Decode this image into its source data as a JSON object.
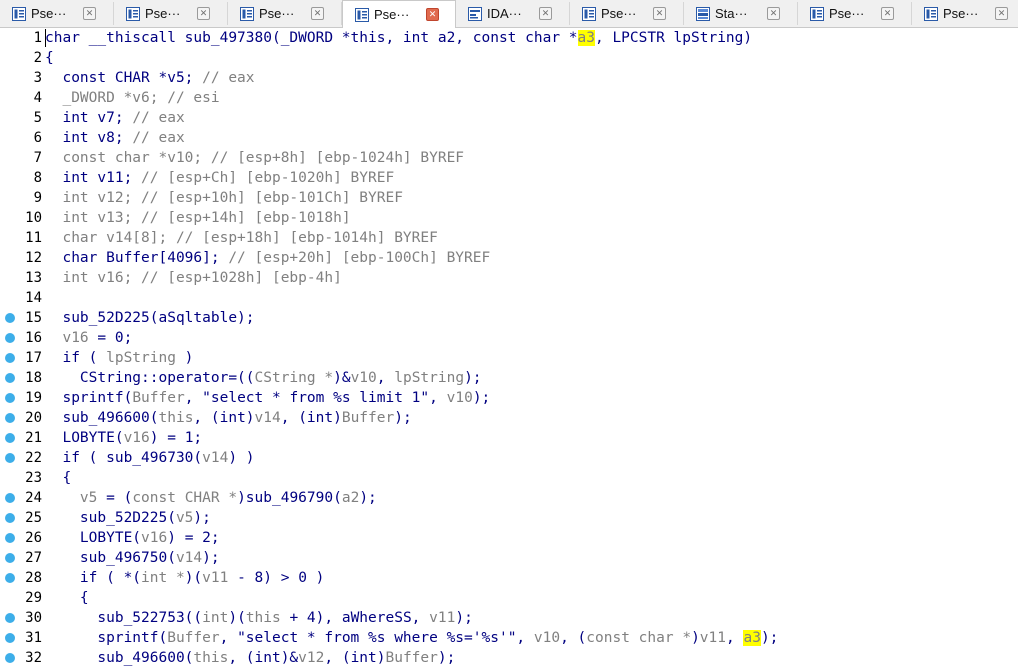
{
  "tabs": [
    {
      "label": "Pse···",
      "icon": "pseudocode-icon",
      "active": false
    },
    {
      "label": "Pse···",
      "icon": "pseudocode-icon",
      "active": false
    },
    {
      "label": "Pse···",
      "icon": "pseudocode-icon",
      "active": false
    },
    {
      "label": "Pse···",
      "icon": "pseudocode-icon",
      "active": true
    },
    {
      "label": "IDA···",
      "icon": "ida-view-icon",
      "active": false
    },
    {
      "label": "Pse···",
      "icon": "pseudocode-icon",
      "active": false
    },
    {
      "label": "Sta···",
      "icon": "stack-view-icon",
      "active": false
    },
    {
      "label": "Pse···",
      "icon": "pseudocode-icon",
      "active": false
    },
    {
      "label": "Pse···",
      "icon": "pseudocode-icon",
      "active": false
    }
  ],
  "colors": {
    "code_text": "#000080",
    "comment_and_var": "#808080",
    "highlight": "#ffff00",
    "breakpoint_dot": "#3daee9",
    "active_tab_close": "#e06b4f"
  },
  "code_lines": [
    {
      "num": "1",
      "dot": false,
      "segs": [
        {
          "t": "char __thiscall sub_497380(_DWORD *this, int a2, const char *"
        },
        {
          "t": "a3",
          "c": "hl"
        },
        {
          "t": ", LPCSTR lpString)"
        }
      ]
    },
    {
      "num": "2",
      "dot": false,
      "segs": [
        {
          "t": "{"
        }
      ]
    },
    {
      "num": "3",
      "dot": false,
      "segs": [
        {
          "t": "  const CHAR *v5; "
        },
        {
          "t": "// eax",
          "c": "g"
        }
      ]
    },
    {
      "num": "4",
      "dot": false,
      "segs": [
        {
          "t": "  _DWORD *v6; ",
          "c": "g"
        },
        {
          "t": "// esi",
          "c": "g"
        }
      ]
    },
    {
      "num": "5",
      "dot": false,
      "segs": [
        {
          "t": "  int v7; "
        },
        {
          "t": "// eax",
          "c": "g"
        }
      ]
    },
    {
      "num": "6",
      "dot": false,
      "segs": [
        {
          "t": "  int v8; "
        },
        {
          "t": "// eax",
          "c": "g"
        }
      ]
    },
    {
      "num": "7",
      "dot": false,
      "segs": [
        {
          "t": "  const char *v10; ",
          "c": "g"
        },
        {
          "t": "// [esp+8h] [ebp-1024h] BYREF",
          "c": "g"
        }
      ]
    },
    {
      "num": "8",
      "dot": false,
      "segs": [
        {
          "t": "  int v11; "
        },
        {
          "t": "// [esp+Ch] [ebp-1020h] BYREF",
          "c": "g"
        }
      ]
    },
    {
      "num": "9",
      "dot": false,
      "segs": [
        {
          "t": "  int v12; ",
          "c": "g"
        },
        {
          "t": "// [esp+10h] [ebp-101Ch] BYREF",
          "c": "g"
        }
      ]
    },
    {
      "num": "10",
      "dot": false,
      "segs": [
        {
          "t": "  int v13; ",
          "c": "g"
        },
        {
          "t": "// [esp+14h] [ebp-1018h]",
          "c": "g"
        }
      ]
    },
    {
      "num": "11",
      "dot": false,
      "segs": [
        {
          "t": "  char v14[8]; ",
          "c": "g"
        },
        {
          "t": "// [esp+18h] [ebp-1014h] BYREF",
          "c": "g"
        }
      ]
    },
    {
      "num": "12",
      "dot": false,
      "segs": [
        {
          "t": "  char Buffer[4096]; "
        },
        {
          "t": "// [esp+20h] [ebp-100Ch] BYREF",
          "c": "g"
        }
      ]
    },
    {
      "num": "13",
      "dot": false,
      "segs": [
        {
          "t": "  int v16; ",
          "c": "g"
        },
        {
          "t": "// [esp+1028h] [ebp-4h]",
          "c": "g"
        }
      ]
    },
    {
      "num": "14",
      "dot": false,
      "segs": [
        {
          "t": ""
        }
      ]
    },
    {
      "num": "15",
      "dot": true,
      "segs": [
        {
          "t": "  sub_52D225(aSqltable);"
        }
      ]
    },
    {
      "num": "16",
      "dot": true,
      "segs": [
        {
          "t": "  "
        },
        {
          "t": "v16",
          "c": "g"
        },
        {
          "t": " = 0;"
        }
      ]
    },
    {
      "num": "17",
      "dot": true,
      "segs": [
        {
          "t": "  if ( "
        },
        {
          "t": "lpString",
          "c": "g"
        },
        {
          "t": " )"
        }
      ]
    },
    {
      "num": "18",
      "dot": true,
      "segs": [
        {
          "t": "    CString::operator=(("
        },
        {
          "t": "CString *",
          "c": "g"
        },
        {
          "t": ")&"
        },
        {
          "t": "v10",
          "c": "g"
        },
        {
          "t": ", "
        },
        {
          "t": "lpString",
          "c": "g"
        },
        {
          "t": ");"
        }
      ]
    },
    {
      "num": "19",
      "dot": true,
      "segs": [
        {
          "t": "  sprintf("
        },
        {
          "t": "Buffer",
          "c": "g"
        },
        {
          "t": ", \"select * from %s limit 1\", "
        },
        {
          "t": "v10",
          "c": "g"
        },
        {
          "t": ");"
        }
      ]
    },
    {
      "num": "20",
      "dot": true,
      "segs": [
        {
          "t": "  sub_496600("
        },
        {
          "t": "this",
          "c": "g"
        },
        {
          "t": ", (int)"
        },
        {
          "t": "v14",
          "c": "g"
        },
        {
          "t": ", (int)"
        },
        {
          "t": "Buffer",
          "c": "g"
        },
        {
          "t": ");"
        }
      ]
    },
    {
      "num": "21",
      "dot": true,
      "segs": [
        {
          "t": "  LOBYTE("
        },
        {
          "t": "v16",
          "c": "g"
        },
        {
          "t": ") = 1;"
        }
      ]
    },
    {
      "num": "22",
      "dot": true,
      "segs": [
        {
          "t": "  if ( sub_496730("
        },
        {
          "t": "v14",
          "c": "g"
        },
        {
          "t": ") )"
        }
      ]
    },
    {
      "num": "23",
      "dot": false,
      "segs": [
        {
          "t": "  {"
        }
      ]
    },
    {
      "num": "24",
      "dot": true,
      "segs": [
        {
          "t": "    "
        },
        {
          "t": "v5",
          "c": "g"
        },
        {
          "t": " = ("
        },
        {
          "t": "const CHAR *",
          "c": "g"
        },
        {
          "t": ")sub_496790("
        },
        {
          "t": "a2",
          "c": "g"
        },
        {
          "t": ");"
        }
      ]
    },
    {
      "num": "25",
      "dot": true,
      "segs": [
        {
          "t": "    sub_52D225("
        },
        {
          "t": "v5",
          "c": "g"
        },
        {
          "t": ");"
        }
      ]
    },
    {
      "num": "26",
      "dot": true,
      "segs": [
        {
          "t": "    LOBYTE("
        },
        {
          "t": "v16",
          "c": "g"
        },
        {
          "t": ") = 2;"
        }
      ]
    },
    {
      "num": "27",
      "dot": true,
      "segs": [
        {
          "t": "    sub_496750("
        },
        {
          "t": "v14",
          "c": "g"
        },
        {
          "t": ");"
        }
      ]
    },
    {
      "num": "28",
      "dot": true,
      "segs": [
        {
          "t": "    if ( *("
        },
        {
          "t": "int *",
          "c": "g"
        },
        {
          "t": ")("
        },
        {
          "t": "v11",
          "c": "g"
        },
        {
          "t": " - 8) > 0 )"
        }
      ]
    },
    {
      "num": "29",
      "dot": false,
      "segs": [
        {
          "t": "    {"
        }
      ]
    },
    {
      "num": "30",
      "dot": true,
      "segs": [
        {
          "t": "      sub_522753(("
        },
        {
          "t": "int",
          "c": "g"
        },
        {
          "t": ")("
        },
        {
          "t": "this",
          "c": "g"
        },
        {
          "t": " + 4), aWhereSS, "
        },
        {
          "t": "v11",
          "c": "g"
        },
        {
          "t": ");"
        }
      ]
    },
    {
      "num": "31",
      "dot": true,
      "segs": [
        {
          "t": "      sprintf("
        },
        {
          "t": "Buffer",
          "c": "g"
        },
        {
          "t": ", \"select * from %s where %s='%s'\", "
        },
        {
          "t": "v10",
          "c": "g"
        },
        {
          "t": ", ("
        },
        {
          "t": "const char *",
          "c": "g"
        },
        {
          "t": ")"
        },
        {
          "t": "v11",
          "c": "g"
        },
        {
          "t": ", "
        },
        {
          "t": "a3",
          "c": "hl"
        },
        {
          "t": ");"
        }
      ]
    },
    {
      "num": "32",
      "dot": true,
      "segs": [
        {
          "t": "      sub_496600("
        },
        {
          "t": "this",
          "c": "g"
        },
        {
          "t": ", (int)&"
        },
        {
          "t": "v12",
          "c": "g"
        },
        {
          "t": ", (int)"
        },
        {
          "t": "Buffer",
          "c": "g"
        },
        {
          "t": ");"
        }
      ]
    }
  ]
}
